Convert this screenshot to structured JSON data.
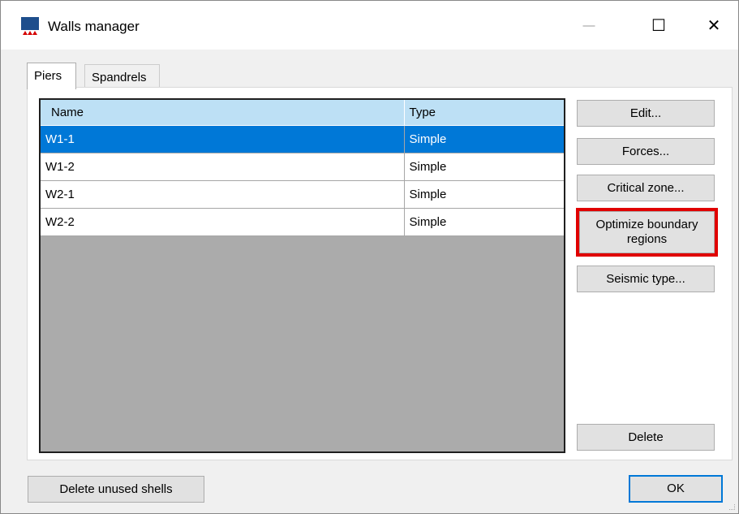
{
  "window": {
    "title": "Walls manager",
    "icons": {
      "app": "walls-app-icon",
      "minimize": "minimize-icon",
      "maximize": "maximize-icon",
      "close": "close-icon"
    },
    "controls": {
      "minimize": "—",
      "maximize": "☐",
      "close": "✕"
    }
  },
  "tabs": [
    {
      "label": "Piers",
      "active": true
    },
    {
      "label": "Spandrels",
      "active": false
    }
  ],
  "grid": {
    "columns": [
      "Name",
      "Type"
    ],
    "rows": [
      {
        "name": "W1-1",
        "type": "Simple",
        "selected": true
      },
      {
        "name": "W1-2",
        "type": "Simple",
        "selected": false
      },
      {
        "name": "W2-1",
        "type": "Simple",
        "selected": false
      },
      {
        "name": "W2-2",
        "type": "Simple",
        "selected": false
      }
    ]
  },
  "buttons": {
    "edit": "Edit...",
    "forces": "Forces...",
    "critical_zone": "Critical zone...",
    "optimize": "Optimize boundary regions",
    "seismic": "Seismic type...",
    "delete": "Delete",
    "delete_unused": "Delete unused shells",
    "ok": "OK"
  },
  "colors": {
    "selection": "#0078d7",
    "header": "#bde0f5",
    "highlight": "#e00000",
    "grid_background": "#ababab"
  }
}
